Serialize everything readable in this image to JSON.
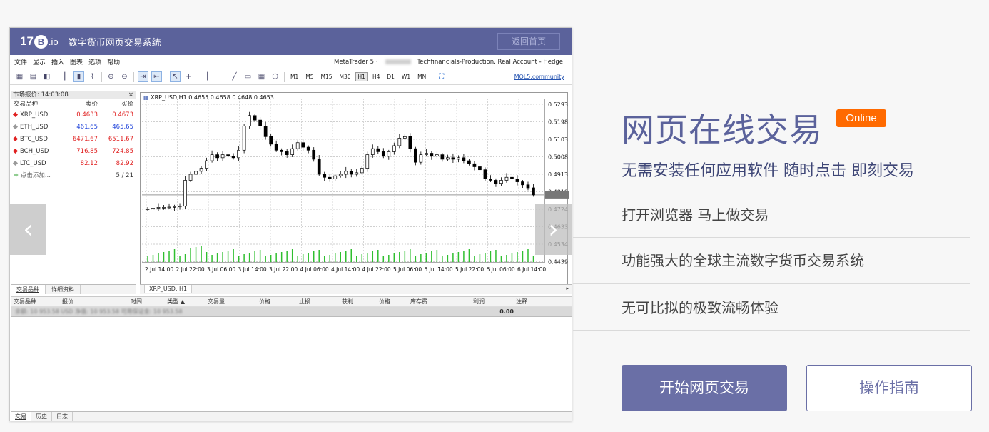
{
  "app": {
    "logo": {
      "prefix": "17",
      "b": "B",
      "suffix": ".io"
    },
    "title": "数字货币网页交易系统",
    "back_button": "返回首页",
    "menu": [
      "文件",
      "显示",
      "插入",
      "图表",
      "选项",
      "帮助"
    ],
    "account": {
      "prefix": "MetaTrader 5 ·",
      "suffix": "Techfinancials-Production, Real Account - Hedge"
    },
    "timeframes": [
      "M1",
      "M5",
      "M15",
      "M30",
      "H1",
      "H4",
      "D1",
      "W1",
      "MN"
    ],
    "active_timeframe": "H1",
    "mql_link": "MQL5.community"
  },
  "watchlist": {
    "title": "市场报价: 14:03:08",
    "close": "×",
    "headers": [
      "交易品种",
      "卖价",
      "买价"
    ],
    "rows": [
      {
        "symbol": "XRP_USD",
        "bid": "0.4633",
        "ask": "0.4673",
        "color": "#e02020"
      },
      {
        "symbol": "ETH_USD",
        "bid": "461.65",
        "ask": "465.65",
        "color": "#1a3fd9"
      },
      {
        "symbol": "BTC_USD",
        "bid": "6471.67",
        "ask": "6511.67",
        "color": "#e02020"
      },
      {
        "symbol": "BCH_USD",
        "bid": "716.85",
        "ask": "724.85",
        "color": "#e02020"
      },
      {
        "symbol": "LTC_USD",
        "bid": "82.12",
        "ask": "82.92",
        "color": "#e02020"
      }
    ],
    "add": "+ 点击添加...",
    "count": "5 / 21",
    "tabs": [
      "交易品种",
      "详细资料"
    ]
  },
  "chart": {
    "header": "XRP_USD,H1  0.4655 0.4658 0.4648 0.4653",
    "tab": "XRP_USD, H1",
    "price_labels": [
      "0.5293",
      "0.5198",
      "0.5103",
      "0.5008",
      "0.4913",
      "0.4819",
      "0.4724",
      "0.4633",
      "0.4534",
      "0.4439"
    ],
    "time_labels": [
      "2 Jul 14:00",
      "2 Jul 22:00",
      "3 Jul 06:00",
      "3 Jul 14:00",
      "3 Jul 22:00",
      "4 Jul 06:00",
      "4 Jul 14:00",
      "4 Jul 22:00",
      "5 Jul 06:00",
      "5 Jul 14:00",
      "5 Jul 22:00",
      "6 Jul 06:00",
      "6 Jul 14:00"
    ]
  },
  "chart_data": {
    "type": "candlestick",
    "title": "XRP_USD,H1",
    "ylim": [
      0.4439,
      0.5293
    ],
    "closes": [
      0.456,
      0.4565,
      0.457,
      0.457,
      0.4572,
      0.4575,
      0.4578,
      0.475,
      0.479,
      0.481,
      0.483,
      0.488,
      0.492,
      0.49,
      0.492,
      0.491,
      0.49,
      0.495,
      0.511,
      0.518,
      0.515,
      0.511,
      0.504,
      0.499,
      0.495,
      0.494,
      0.492,
      0.496,
      0.5,
      0.497,
      0.495,
      0.489,
      0.479,
      0.477,
      0.476,
      0.478,
      0.479,
      0.481,
      0.479,
      0.48,
      0.483,
      0.492,
      0.496,
      0.494,
      0.491,
      0.494,
      0.498,
      0.503,
      0.504,
      0.496,
      0.487,
      0.492,
      0.493,
      0.491,
      0.492,
      0.489,
      0.49,
      0.489,
      0.49,
      0.488,
      0.486,
      0.484,
      0.482,
      0.476,
      0.475,
      0.473,
      0.475,
      0.477,
      0.476,
      0.474,
      0.472,
      0.47,
      0.4653
    ],
    "volume_color": "#2fbf2f"
  },
  "terminal": {
    "headers": [
      "交易品种",
      "报价",
      "时间",
      "类型 ▲",
      "交易量",
      "价格",
      "止损",
      "获利",
      "价格",
      "库存费",
      "利润",
      "注释"
    ],
    "summary": "余额: 10 953.58 USD  净值: 10 953.58  可用保证金: 10 953.58",
    "profit": "0.00",
    "tabs": [
      "交易",
      "历史",
      "日志"
    ]
  },
  "promo": {
    "headline": "网页在线交易",
    "badge": "Online",
    "subtitle": "无需安装任何应用软件 随时点击 即刻交易",
    "features": [
      "打开浏览器 马上做交易",
      "功能强大的全球主流数字货币交易系统",
      "无可比拟的极致流畅体验"
    ],
    "primary_button": "开始网页交易",
    "secondary_button": "操作指南"
  },
  "carousel": {
    "prev": "‹",
    "next": "›"
  }
}
